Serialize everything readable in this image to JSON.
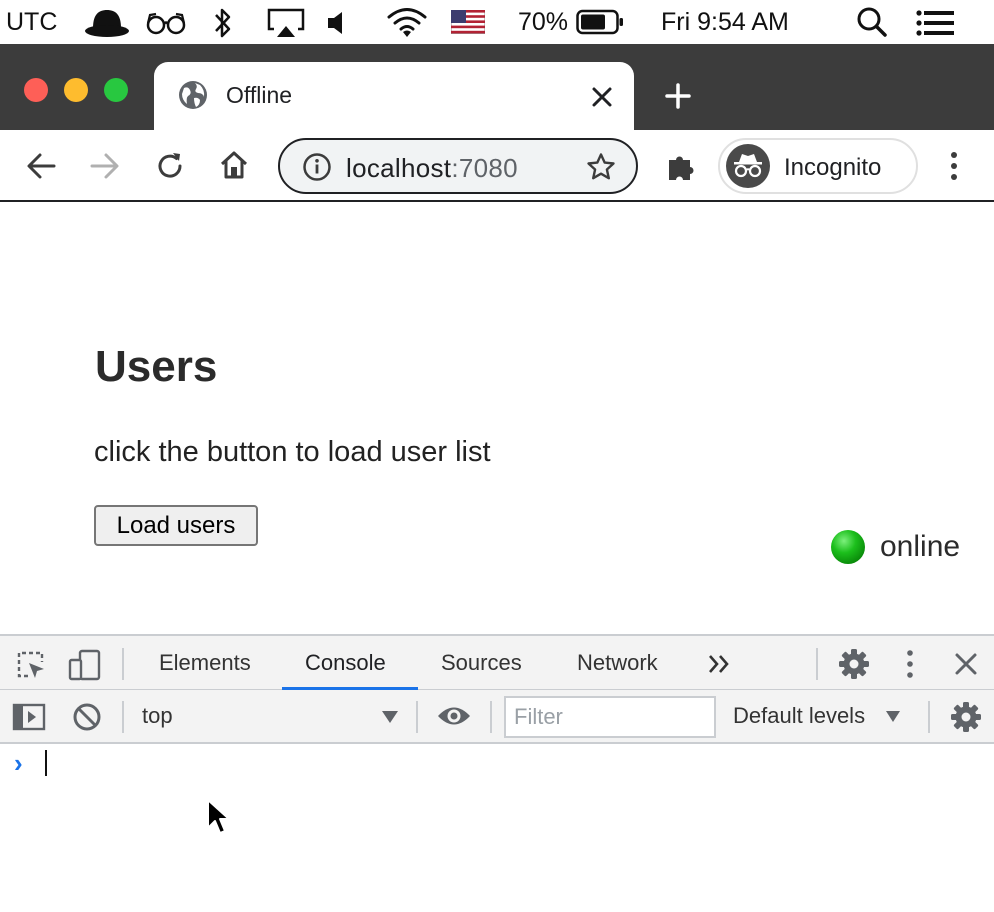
{
  "menubar": {
    "timezone": "UTC",
    "battery": "70%",
    "clock": "Fri 9:54 AM",
    "icons": [
      "bowler-hat-icon",
      "glasses-icon",
      "bluetooth-icon",
      "airplay-icon",
      "volume-icon",
      "wifi-icon",
      "us-flag-icon",
      "battery-icon",
      "spotlight-search-icon",
      "control-center-list-icon"
    ]
  },
  "browser": {
    "tab_title": "Offline",
    "url_host": "localhost",
    "url_port": ":7080",
    "profile_label": "Incognito"
  },
  "page": {
    "heading": "Users",
    "description": "click the button to load user list",
    "load_button": "Load users",
    "status": {
      "label": "online",
      "color": "#1cbf1c"
    }
  },
  "devtools": {
    "tabs": [
      {
        "label": "Elements",
        "active": false
      },
      {
        "label": "Console",
        "active": true
      },
      {
        "label": "Sources",
        "active": false
      },
      {
        "label": "Network",
        "active": false
      }
    ],
    "context": "top",
    "filter_placeholder": "Filter",
    "levels": "Default levels",
    "prompt": "›",
    "accent": "#1a73e8"
  }
}
